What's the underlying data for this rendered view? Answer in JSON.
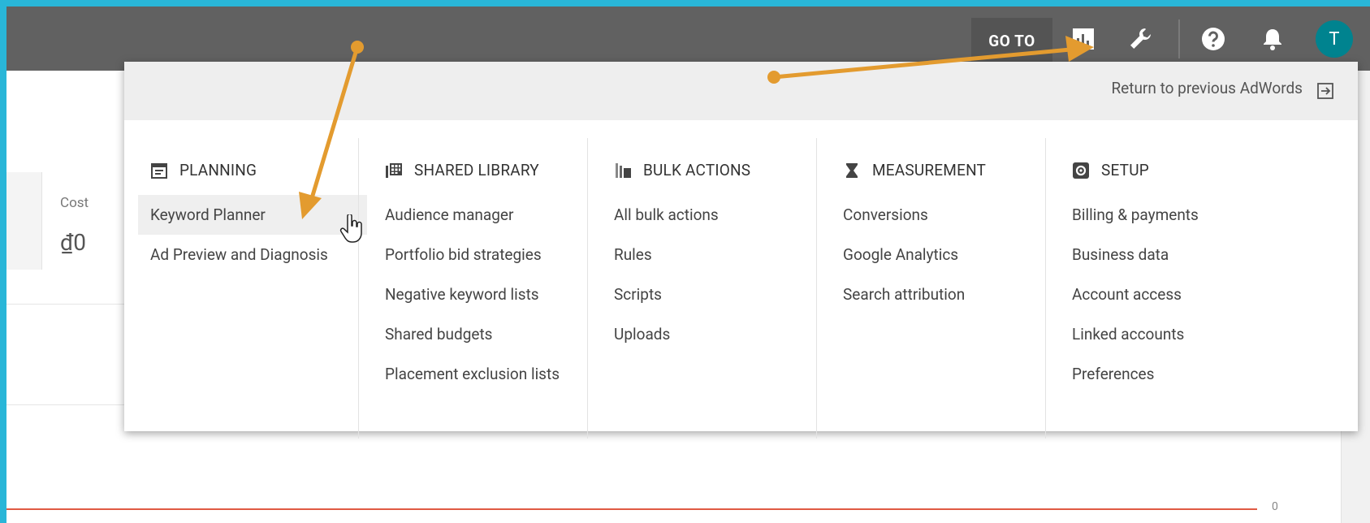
{
  "topbar": {
    "goto_label": "GO TO",
    "avatar_letter": "T",
    "colors": {
      "bar": "#616161",
      "avatar": "#00838f"
    }
  },
  "background": {
    "stat_label": "Cost",
    "stat_value": "₫0",
    "axis_zero": "0"
  },
  "menu": {
    "return_label": "Return to previous AdWords",
    "columns": [
      {
        "heading": "PLANNING",
        "icon": "calendar-icon",
        "items": [
          "Keyword Planner",
          "Ad Preview and Diagnosis"
        ],
        "active_index": 0
      },
      {
        "heading": "SHARED LIBRARY",
        "icon": "library-icon",
        "items": [
          "Audience manager",
          "Portfolio bid strategies",
          "Negative keyword lists",
          "Shared budgets",
          "Placement exclusion lists"
        ]
      },
      {
        "heading": "BULK ACTIONS",
        "icon": "copy-icon",
        "items": [
          "All bulk actions",
          "Rules",
          "Scripts",
          "Uploads"
        ]
      },
      {
        "heading": "MEASUREMENT",
        "icon": "hourglass-icon",
        "items": [
          "Conversions",
          "Google Analytics",
          "Search attribution"
        ]
      },
      {
        "heading": "SETUP",
        "icon": "gear-icon",
        "items": [
          "Billing & payments",
          "Business data",
          "Account access",
          "Linked accounts",
          "Preferences"
        ]
      }
    ]
  },
  "annotation_color": "#e39b2f"
}
